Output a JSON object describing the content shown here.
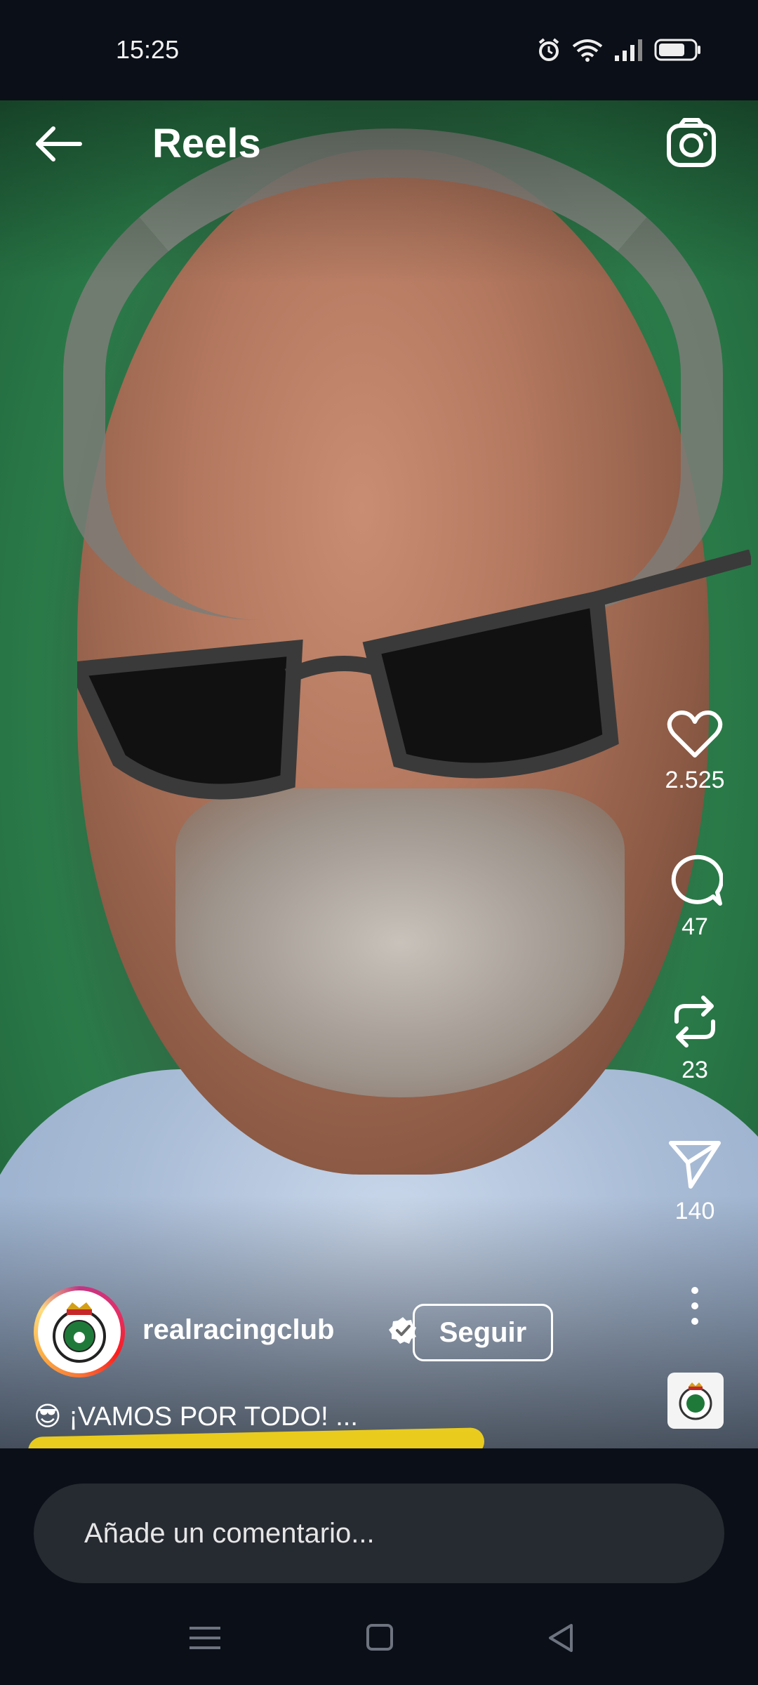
{
  "status_bar": {
    "time": "15:25",
    "icons": [
      "alarm-icon",
      "wifi-icon",
      "signal-icon",
      "battery-icon"
    ]
  },
  "header": {
    "title": "Reels",
    "back_icon": "arrow-left-icon",
    "camera_icon": "camera-icon"
  },
  "actions": {
    "like": {
      "icon": "heart-icon",
      "count": "2.525"
    },
    "comment": {
      "icon": "comment-icon",
      "count": "47"
    },
    "repost": {
      "icon": "repost-icon",
      "count": "23"
    },
    "share": {
      "icon": "send-icon",
      "count": "140"
    },
    "more_icon": "more-vertical-icon"
  },
  "author": {
    "username": "realracingclub",
    "verified": true,
    "follow_label": "Seguir"
  },
  "caption": {
    "emoji": "😎",
    "text": "¡VAMOS POR TODO! ..."
  },
  "comment": {
    "placeholder": "Añade un comentario..."
  },
  "nav": {
    "icons": [
      "menu-icon",
      "home-square-icon",
      "back-triangle-icon"
    ]
  },
  "colors": {
    "background": "#0b0f17",
    "input_bg": "#262a31",
    "highlight": "#f1d21a"
  }
}
